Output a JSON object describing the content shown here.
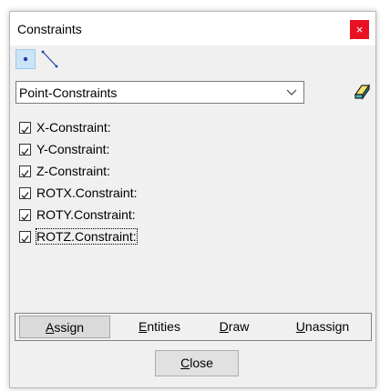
{
  "window": {
    "title": "Constraints",
    "close_glyph": "×"
  },
  "toolbar": {
    "items": [
      {
        "icon": "point-select-icon",
        "active": true
      },
      {
        "icon": "line-select-icon",
        "active": false
      }
    ]
  },
  "selector": {
    "value": "Point-Constraints",
    "icon": "chevron-down-icon"
  },
  "eraser": {
    "icon": "eraser-icon"
  },
  "constraints": [
    {
      "label": "X-Constraint:",
      "checked": true
    },
    {
      "label": "Y-Constraint:",
      "checked": true
    },
    {
      "label": "Z-Constraint:",
      "checked": true
    },
    {
      "label": "ROTX.Constraint:",
      "checked": true
    },
    {
      "label": "ROTY.Constraint:",
      "checked": true
    },
    {
      "label": "ROTZ.Constraint:",
      "checked": true
    }
  ],
  "tabs": [
    {
      "label": "Assign",
      "mnemonic": "A",
      "active": true
    },
    {
      "label": "Entities",
      "mnemonic": "E",
      "active": false
    },
    {
      "label": "Draw",
      "mnemonic": "D",
      "active": false
    },
    {
      "label": "Unassign",
      "mnemonic": "U",
      "active": false
    }
  ],
  "footer": {
    "close_label": "Close",
    "close_mnemonic": "C"
  },
  "colors": {
    "close_red": "#e81123",
    "selected_tool": "#cce4f7",
    "eraser_yellow": "#f7e36b",
    "eraser_teal": "#3fb7b0"
  }
}
